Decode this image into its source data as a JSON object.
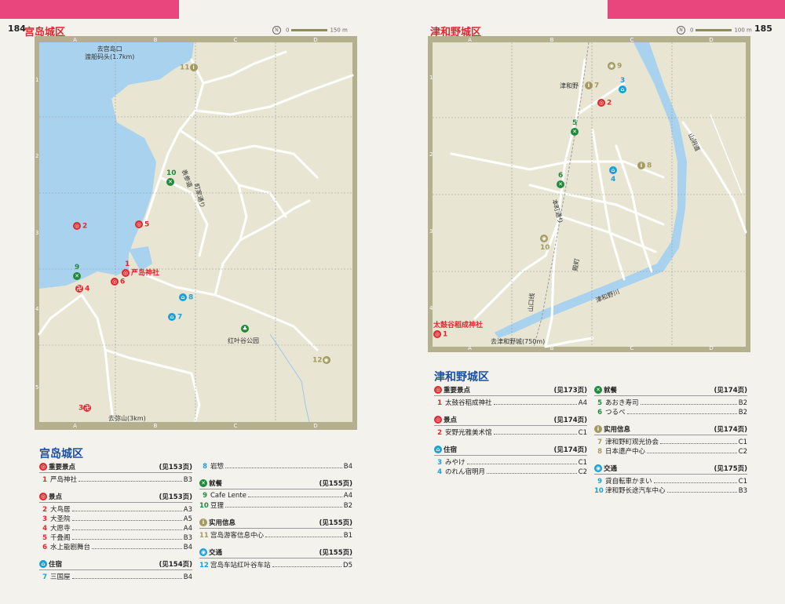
{
  "left": {
    "page_number": "184",
    "title": "宫岛城区",
    "scale_label": "150 m",
    "scale_zero": "0",
    "compass": "N",
    "grid": {
      "cols": [
        "A",
        "B",
        "C",
        "D"
      ],
      "rows": [
        "1",
        "2",
        "3",
        "4",
        "5"
      ]
    },
    "labels": {
      "ferry": "去宫岛口\n渡船码头(1.7km)",
      "road_omote": "表参道",
      "road_machiya": "町家通り",
      "park": "红叶谷公园",
      "misen": "去弥山(3km)"
    },
    "markers": {
      "m1": {
        "num": "1",
        "name": "严岛神社"
      },
      "m2": "2",
      "m3": "3",
      "m4": "4",
      "m5": "5",
      "m6": "6",
      "m7": "7",
      "m8": "8",
      "m9": "9",
      "m10": "10",
      "m11": "11",
      "m12": "12"
    },
    "legend_title": "宫岛城区",
    "groups": [
      {
        "key": "sights_main",
        "label": "重要景点",
        "ref": "(见153页)",
        "items": [
          {
            "num": "1",
            "name": "严岛神社",
            "ref": "B3"
          }
        ]
      },
      {
        "key": "sights",
        "label": "景点",
        "ref": "(见153页)",
        "items": [
          {
            "num": "2",
            "name": "大鸟居",
            "ref": "A3"
          },
          {
            "num": "3",
            "name": "大圣院",
            "ref": "A5"
          },
          {
            "num": "4",
            "name": "大愿寺",
            "ref": "A4"
          },
          {
            "num": "5",
            "name": "千叠阁",
            "ref": "B3"
          },
          {
            "num": "6",
            "name": "水上能剧舞台",
            "ref": "B4"
          }
        ]
      },
      {
        "key": "sleep",
        "label": "住宿",
        "ref": "(见154页)",
        "items": [
          {
            "num": "7",
            "name": "三国屋",
            "ref": "B4"
          },
          {
            "num": "8",
            "name": "岩惣",
            "ref": "B4"
          }
        ]
      },
      {
        "key": "eat",
        "label": "就餐",
        "ref": "(见155页)",
        "items": [
          {
            "num": "9",
            "name": "Cafe Lente",
            "ref": "A4"
          },
          {
            "num": "10",
            "name": "豆狸",
            "ref": "B2"
          }
        ]
      },
      {
        "key": "info",
        "label": "实用信息",
        "ref": "(见155页)",
        "items": [
          {
            "num": "11",
            "name": "宫岛游客信息中心",
            "ref": "B1"
          }
        ]
      },
      {
        "key": "transport",
        "label": "交通",
        "ref": "(见155页)",
        "items": [
          {
            "num": "12",
            "name": "宫岛车站红叶谷车站",
            "ref": "D5"
          }
        ]
      }
    ]
  },
  "right": {
    "page_number": "185",
    "title": "津和野城区",
    "scale_label": "100 m",
    "scale_zero": "0",
    "compass": "N",
    "grid": {
      "cols": [
        "A",
        "B",
        "C",
        "D"
      ],
      "rows": [
        "1",
        "2",
        "3",
        "4"
      ]
    },
    "labels": {
      "station": "津和野",
      "river": "津和野川",
      "sanin": "山阴道",
      "tonomachi": "殿町",
      "honmachi": "本町通り",
      "yamaguchi": "山口线",
      "castle": "去津和野城(750m)"
    },
    "markers": {
      "m1": {
        "name": "太鼓谷稻成神社",
        "num": "1"
      },
      "m2": "2",
      "m3": "3",
      "m4": "4",
      "m5": "5",
      "m6": "6",
      "m7": "7",
      "m8": "8",
      "m9": "9",
      "m10": "10"
    },
    "legend_title": "津和野城区",
    "groups": [
      {
        "key": "sights_main",
        "label": "重要景点",
        "ref": "(见173页)",
        "items": [
          {
            "num": "1",
            "name": "太鼓谷稻成神社",
            "ref": "A4"
          }
        ]
      },
      {
        "key": "sights",
        "label": "景点",
        "ref": "(见174页)",
        "items": [
          {
            "num": "2",
            "name": "安野光雅美术馆",
            "ref": "C1"
          }
        ]
      },
      {
        "key": "sleep",
        "label": "住宿",
        "ref": "(见174页)",
        "items": [
          {
            "num": "3",
            "name": "みやけ",
            "ref": "C1"
          },
          {
            "num": "4",
            "name": "のれん宿明月",
            "ref": "C2"
          }
        ]
      },
      {
        "key": "eat",
        "label": "就餐",
        "ref": "(见174页)",
        "items": [
          {
            "num": "5",
            "name": "あおき寿司",
            "ref": "B2"
          },
          {
            "num": "6",
            "name": "つるべ",
            "ref": "B2"
          }
        ]
      },
      {
        "key": "info",
        "label": "实用信息",
        "ref": "(见174页)",
        "items": [
          {
            "num": "7",
            "name": "津和野町观光协会",
            "ref": "C1"
          },
          {
            "num": "8",
            "name": "日本遗产中心",
            "ref": "C2"
          }
        ]
      },
      {
        "key": "transport",
        "label": "交通",
        "ref": "(见175页)",
        "items": [
          {
            "num": "9",
            "name": "貸自転車かまい",
            "ref": "C1"
          },
          {
            "num": "10",
            "name": "津和野长途汽车中心",
            "ref": "B3"
          }
        ]
      }
    ]
  },
  "icons": {
    "sights_main": {
      "glyph": "◎",
      "color": "#e0262d",
      "name": "sight-top-icon"
    },
    "sights": {
      "glyph": "◎",
      "color": "#e0262d",
      "name": "sight-icon"
    },
    "sleep": {
      "glyph": "⌂",
      "color": "#1aa0d8",
      "name": "bed-icon"
    },
    "eat": {
      "glyph": "✕",
      "color": "#1f8a3c",
      "name": "fork-knife-icon"
    },
    "info": {
      "glyph": "i",
      "color": "#a49a60",
      "name": "info-icon"
    },
    "transport": {
      "glyph": "◉",
      "color": "#1aa0d8",
      "name": "transport-icon"
    }
  }
}
